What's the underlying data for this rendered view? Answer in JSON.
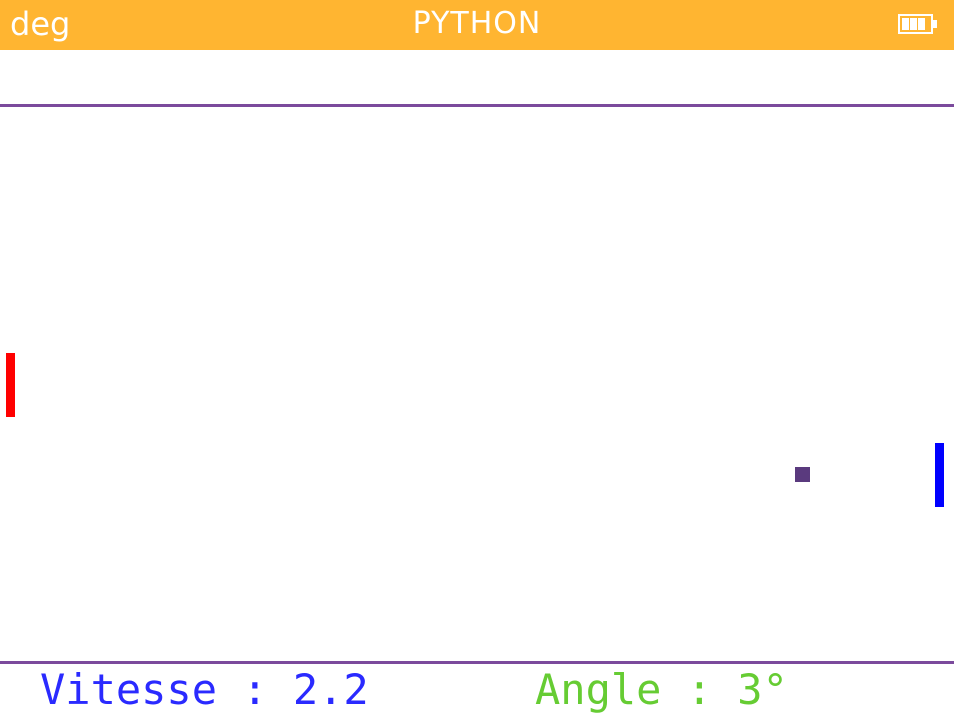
{
  "status_bar": {
    "angle_mode": "deg",
    "title": "PYTHON",
    "battery_icon": "battery-icon",
    "color": "#FFB531"
  },
  "game": {
    "left_paddle_color": "#FF0000",
    "right_paddle_color": "#0000FF",
    "ball_color": "#5A3A7E",
    "border_color": "#7B4A9C"
  },
  "hud": {
    "speed_text": "Vitesse : 2.2",
    "angle_text": "Angle : 3°",
    "speed_color": "#2A2AFF",
    "angle_color": "#66CC33"
  }
}
